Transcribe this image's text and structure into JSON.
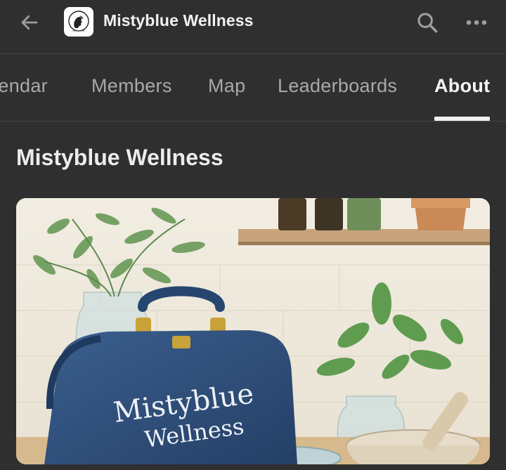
{
  "header": {
    "title": "Mistyblue Wellness",
    "back_icon": "arrow-left-icon",
    "search_icon": "search-icon",
    "more_icon": "more-horizontal-icon"
  },
  "tabs": [
    {
      "label": "Calendar",
      "active": false
    },
    {
      "label": "Members",
      "active": false
    },
    {
      "label": "Map",
      "active": false
    },
    {
      "label": "Leaderboards",
      "active": false
    },
    {
      "label": "About",
      "active": true
    }
  ],
  "main": {
    "page_title": "Mistyblue Wellness",
    "hero_text_line1": "Mistyblue",
    "hero_text_line2": "Wellness"
  },
  "colors": {
    "background": "#2f2f2f",
    "divider": "#474747",
    "active_tab": "#f4f4f4",
    "inactive_tab": "#a9a9a9",
    "bag_blue": "#2e4d78"
  }
}
